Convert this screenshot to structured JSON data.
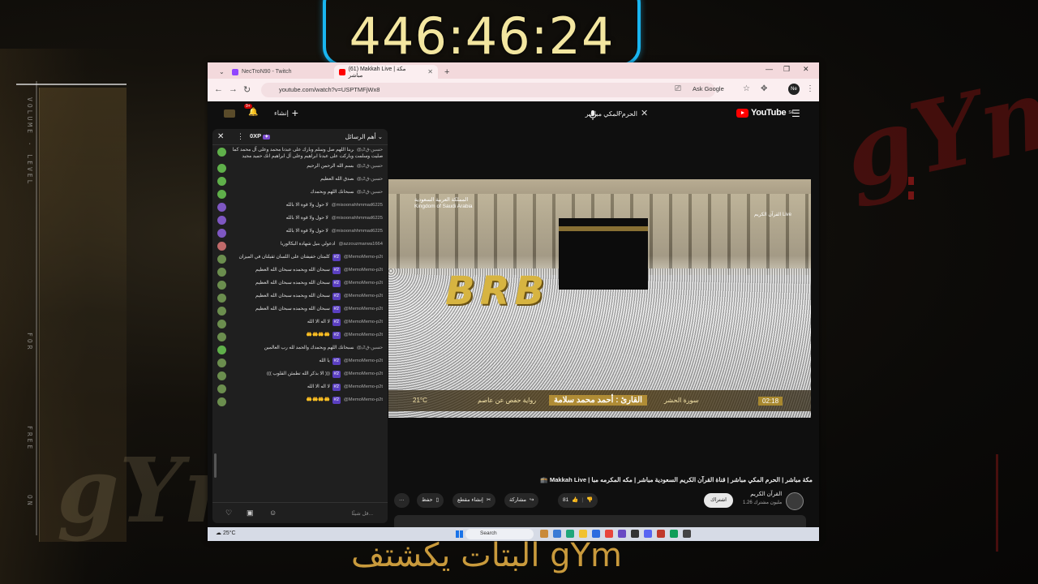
{
  "overlay": {
    "timer": "446:46:24",
    "bottom_caption": "البتات يكشتف gYm",
    "side_labels": [
      "VOLUME · LEVEL",
      "FOR",
      "FREE",
      "ON"
    ]
  },
  "browser": {
    "tabs": [
      {
        "label": "NecTroN90 - Twitch",
        "active": false,
        "color": "#9146ff"
      },
      {
        "label": "(61) Makkah Live | مكة مباشر",
        "active": true,
        "color": "#ff0000"
      }
    ],
    "new_tab": "+",
    "url": "youtube.com/watch?v=USPTMFjWx8",
    "ask_google": "Ask Google"
  },
  "youtube": {
    "logo_text": "YouTube",
    "logo_sup": "SA",
    "search_value": "الحرم المكي مباشر",
    "create_label": "إنشاء",
    "notifications_badge": "9+"
  },
  "chat": {
    "title": "أهم الرسائل",
    "points": "0XP",
    "input_placeholder": "قل شيئًا...",
    "messages": [
      {
        "author": "@حسين-ق2ي",
        "text": "ربنا اللهم صل وسلم وبارك على عبدنا محمد وعلى آل محمد كما صليت وسلمت وباركت على عبدنا ابراهيم وعلى آل ابراهيم انك حميد مجيد",
        "badge": "",
        "color": "#5fb04a"
      },
      {
        "author": "@حسين-ق2ي",
        "text": "بسم الله الرحمن الرحيم",
        "badge": "",
        "color": "#5fb04a"
      },
      {
        "author": "@حسين-ق2ي",
        "text": "صدق الله العظيم",
        "badge": "",
        "color": "#5fb04a"
      },
      {
        "author": "@حسين-ق2ي",
        "text": "سبحانك اللهم وبحمدك",
        "badge": "",
        "color": "#5fb04a"
      },
      {
        "author": "@misoonahhmmad6225",
        "text": "لا حول ولا قوة الا بالله",
        "badge": "",
        "color": "#7e57c2"
      },
      {
        "author": "@misoonahhmmad6225",
        "text": "لا حول ولا قوة الا بالله",
        "badge": "",
        "color": "#7e57c2"
      },
      {
        "author": "@misoonahhmmad6225",
        "text": "لا حول ولا قوة الا بالله",
        "badge": "",
        "color": "#7e57c2"
      },
      {
        "author": "@azzouzmarwa1664",
        "text": "ادعولي بنيل شهادة البكالوريا",
        "badge": "",
        "color": "#c06a6a"
      },
      {
        "author": "@MemoMemo-p2t",
        "text": "كلمتان خفيفتان على اللسان ثقيلتان في الميزان",
        "badge": "#2",
        "color": "#6b8e4e"
      },
      {
        "author": "@MemoMemo-p2t",
        "text": "سبحان الله وبحمده سبحان الله العظيم",
        "badge": "#2",
        "color": "#6b8e4e"
      },
      {
        "author": "@MemoMemo-p2t",
        "text": "سبحان الله وبحمده سبحان الله العظيم",
        "badge": "#2",
        "color": "#6b8e4e"
      },
      {
        "author": "@MemoMemo-p2t",
        "text": "سبحان الله وبحمده سبحان الله العظيم",
        "badge": "#2",
        "color": "#6b8e4e"
      },
      {
        "author": "@MemoMemo-p2t",
        "text": "سبحان الله وبحمده سبحان الله العظيم",
        "badge": "#2",
        "color": "#6b8e4e"
      },
      {
        "author": "@MemoMemo-p2t",
        "text": "لا اله الا الله",
        "badge": "#2",
        "color": "#6b8e4e"
      },
      {
        "author": "@MemoMemo-p2t",
        "text": "🤲🤲🤲🤲",
        "badge": "#2",
        "color": "#6b8e4e"
      },
      {
        "author": "@حسين-ق2ي",
        "text": "سبحانك اللهم وبحمدك والحمد لله رب العالمين",
        "badge": "",
        "color": "#5fb04a"
      },
      {
        "author": "@MemoMemo-p2t",
        "text": "يا الله",
        "badge": "#2",
        "color": "#6b8e4e"
      },
      {
        "author": "@MemoMemo-p2t",
        "text": "((( الا بذكر الله تطمئن القلوب )))",
        "badge": "#2",
        "color": "#6b8e4e"
      },
      {
        "author": "@MemoMemo-p2t",
        "text": "لا اله الا الله",
        "badge": "#2",
        "color": "#6b8e4e"
      },
      {
        "author": "@MemoMemo-p2t",
        "text": "🤲🤲🤲🤲",
        "badge": "#2",
        "color": "#6b8e4e"
      }
    ]
  },
  "video": {
    "brb": "BRB",
    "ksa_ar": "المملكة العربية السعودية",
    "ksa_en": "Kingdom of Saudi Arabia",
    "live_logo": "القرآن الكريم Live",
    "surah": "سورة الحشر",
    "reader": "القارئ : أحمد محمد سلامة",
    "riwaya": "رواية حفص عن عاصم",
    "temp": "21°C",
    "clock": "02:18"
  },
  "below": {
    "title": "مكة مباشر | الحرم المكي مباشر | قناة القرآن الكريم السعودية مباشر | مكه المكرمه مبا | Makkah Live 🕋",
    "channel_name": "القرآن الكريم",
    "subscribers": "1.26 مليون مشترك",
    "subscribe_label": "اشتراك",
    "likes": "81",
    "share_label": "مشاركة",
    "clip_label": "إنشاء مقطع",
    "save_label": "حفظ",
    "more_label": "···"
  },
  "taskbar": {
    "temp": "25°C",
    "search_placeholder": "Search"
  }
}
